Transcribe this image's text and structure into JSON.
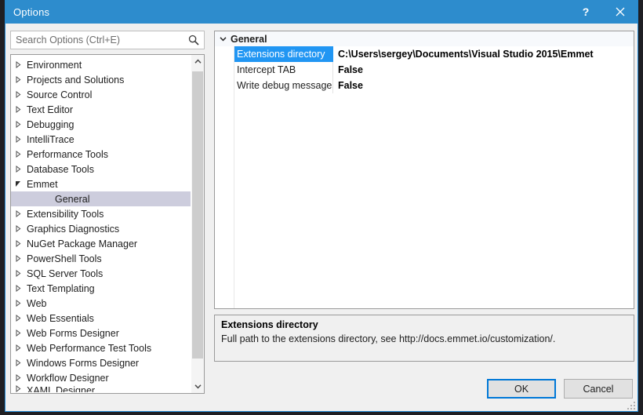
{
  "window": {
    "title": "Options",
    "accent_color": "#2d8ccd",
    "border_color": "#2389d4",
    "help_icon": "question-mark-icon",
    "close_icon": "close-icon"
  },
  "search": {
    "placeholder": "Search Options (Ctrl+E)",
    "value": "",
    "icon": "search-icon"
  },
  "tree": {
    "selected": "General",
    "selection_color": "#cdcddd",
    "scrollbar": {
      "up_icon": "chevron-up-icon",
      "down_icon": "chevron-down-icon"
    },
    "items": [
      {
        "label": "Environment",
        "level": 0,
        "state": "collapsed"
      },
      {
        "label": "Projects and Solutions",
        "level": 0,
        "state": "collapsed"
      },
      {
        "label": "Source Control",
        "level": 0,
        "state": "collapsed"
      },
      {
        "label": "Text Editor",
        "level": 0,
        "state": "collapsed"
      },
      {
        "label": "Debugging",
        "level": 0,
        "state": "collapsed"
      },
      {
        "label": "IntelliTrace",
        "level": 0,
        "state": "collapsed"
      },
      {
        "label": "Performance Tools",
        "level": 0,
        "state": "collapsed"
      },
      {
        "label": "Database Tools",
        "level": 0,
        "state": "collapsed"
      },
      {
        "label": "Emmet",
        "level": 0,
        "state": "expanded"
      },
      {
        "label": "General",
        "level": 1,
        "state": "leaf",
        "selected": true
      },
      {
        "label": "Extensibility Tools",
        "level": 0,
        "state": "collapsed"
      },
      {
        "label": "Graphics Diagnostics",
        "level": 0,
        "state": "collapsed"
      },
      {
        "label": "NuGet Package Manager",
        "level": 0,
        "state": "collapsed"
      },
      {
        "label": "PowerShell Tools",
        "level": 0,
        "state": "collapsed"
      },
      {
        "label": "SQL Server Tools",
        "level": 0,
        "state": "collapsed"
      },
      {
        "label": "Text Templating",
        "level": 0,
        "state": "collapsed"
      },
      {
        "label": "Web",
        "level": 0,
        "state": "collapsed"
      },
      {
        "label": "Web Essentials",
        "level": 0,
        "state": "collapsed"
      },
      {
        "label": "Web Forms Designer",
        "level": 0,
        "state": "collapsed"
      },
      {
        "label": "Web Performance Test Tools",
        "level": 0,
        "state": "collapsed"
      },
      {
        "label": "Windows Forms Designer",
        "level": 0,
        "state": "collapsed"
      },
      {
        "label": "Workflow Designer",
        "level": 0,
        "state": "collapsed"
      },
      {
        "label": "XAML Designer",
        "level": 0,
        "state": "collapsed",
        "clipped": true
      }
    ]
  },
  "propertygrid": {
    "category": {
      "label": "General",
      "expander_icon": "chevron-down-icon",
      "expanded": true
    },
    "selection_color": "#2196f3",
    "rows": [
      {
        "name": "Extensions directory",
        "value": "C:\\Users\\sergey\\Documents\\Visual Studio 2015\\Emmet",
        "selected": true
      },
      {
        "name": "Intercept TAB",
        "value": "False",
        "selected": false
      },
      {
        "name": "Write debug messages",
        "value": "False",
        "selected": false
      }
    ]
  },
  "description": {
    "title": "Extensions directory",
    "text": "Full path to the extensions directory, see http://docs.emmet.io/customization/."
  },
  "footer": {
    "ok_label": "OK",
    "cancel_label": "Cancel",
    "default_button_color": "#0078d7"
  }
}
